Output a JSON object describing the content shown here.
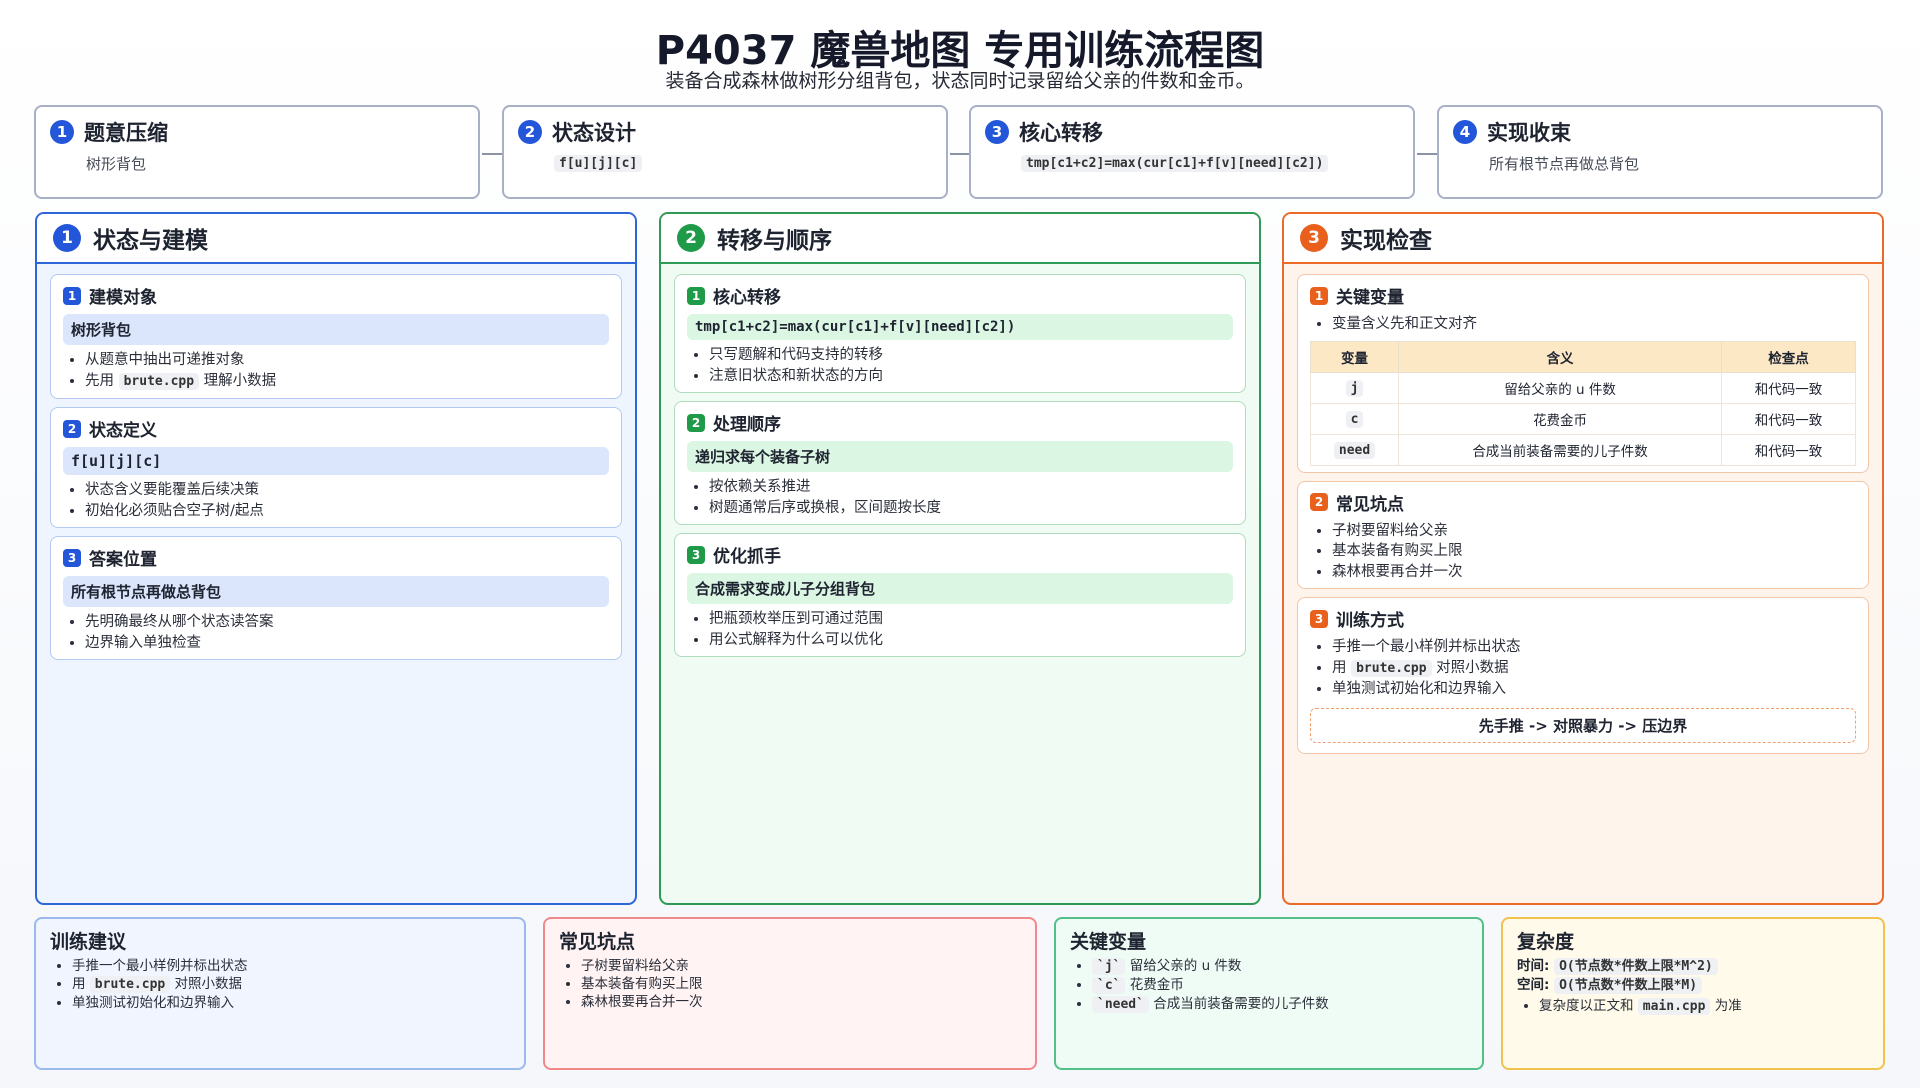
{
  "header": {
    "title": "P4037 魔兽地图 专用训练流程图",
    "subtitle": "装备合成森林做树形分组背包，状态同时记录留给父亲的件数和金币。"
  },
  "flow": [
    {
      "num": "1",
      "title": "题意压缩",
      "desc": "树形背包",
      "mono": false
    },
    {
      "num": "2",
      "title": "状态设计",
      "desc": "f[u][j][c]",
      "mono": true
    },
    {
      "num": "3",
      "title": "核心转移",
      "desc": "tmp[c1+c2]=max(cur[c1]+f[v][need][c2])",
      "mono": true
    },
    {
      "num": "4",
      "title": "实现收束",
      "desc": "所有根节点再做总背包",
      "mono": false
    }
  ],
  "columns": {
    "state": {
      "num": "1",
      "title": "状态与建模",
      "items": [
        {
          "num": "1",
          "title": "建模对象",
          "highlight": "树形背包",
          "bullets": [
            "从题意中抽出可递推对象"
          ],
          "b2_pre": "先用 ",
          "b2_code": "brute.cpp",
          "b2_post": " 理解小数据"
        },
        {
          "num": "2",
          "title": "状态定义",
          "highlight": "f[u][j][c]",
          "bullets": [
            "状态含义要能覆盖后续决策",
            "初始化必须贴合空子树/起点"
          ]
        },
        {
          "num": "3",
          "title": "答案位置",
          "highlight": "所有根节点再做总背包",
          "bullets": [
            "先明确最终从哪个状态读答案",
            "边界输入单独检查"
          ]
        }
      ]
    },
    "transfer": {
      "num": "2",
      "title": "转移与顺序",
      "items": [
        {
          "num": "1",
          "title": "核心转移",
          "highlight": "tmp[c1+c2]=max(cur[c1]+f[v][need][c2])",
          "bullets": [
            "只写题解和代码支持的转移",
            "注意旧状态和新状态的方向"
          ]
        },
        {
          "num": "2",
          "title": "处理顺序",
          "highlight": "递归求每个装备子树",
          "bullets": [
            "按依赖关系推进",
            "树题通常后序或换根，区间题按长度"
          ]
        },
        {
          "num": "3",
          "title": "优化抓手",
          "highlight": "合成需求变成儿子分组背包",
          "bullets": [
            "把瓶颈枚举压到可通过范围",
            "用公式解释为什么可以优化"
          ]
        }
      ]
    },
    "impl": {
      "num": "3",
      "title": "实现检查",
      "vars": {
        "num": "1",
        "title": "关键变量",
        "note": "变量含义先和正文对齐",
        "headers": [
          "变量",
          "含义",
          "检查点"
        ],
        "rows": [
          [
            "j",
            "留给父亲的 u 件数",
            "和代码一致"
          ],
          [
            "c",
            "花费金币",
            "和代码一致"
          ],
          [
            "need",
            "合成当前装备需要的儿子件数",
            "和代码一致"
          ]
        ]
      },
      "pitfalls": {
        "num": "2",
        "title": "常见坑点",
        "bullets": [
          "子树要留料给父亲",
          "基本装备有购买上限",
          "森林根要再合并一次"
        ]
      },
      "training": {
        "num": "3",
        "title": "训练方式",
        "b1": "手推一个最小样例并标出状态",
        "b2_pre": "用 ",
        "b2_code": "brute.cpp",
        "b2_post": " 对照小数据",
        "b3": "单独测试初始化和边界输入",
        "chip": "先手推 -> 对照暴力 -> 压边界"
      }
    }
  },
  "bottom": {
    "advice": {
      "title": "训练建议",
      "b1": "手推一个最小样例并标出状态",
      "b2_pre": "用 ",
      "b2_code": "brute.cpp",
      "b2_post": " 对照小数据",
      "b3": "单独测试初始化和边界输入"
    },
    "pitfalls": {
      "title": "常见坑点",
      "bullets": [
        "子树要留料给父亲",
        "基本装备有购买上限",
        "森林根要再合并一次"
      ]
    },
    "vars": {
      "title": "关键变量",
      "items": [
        {
          "code": "`j`",
          "text": " 留给父亲的 u 件数"
        },
        {
          "code": "`c`",
          "text": " 花费金币"
        },
        {
          "code": "`need`",
          "text": " 合成当前装备需要的儿子件数"
        }
      ]
    },
    "complexity": {
      "title": "复杂度",
      "time_label": "时间:",
      "time_value": "O(节点数*件数上限*M^2)",
      "space_label": "空间:",
      "space_value": "O(节点数*件数上限*M)",
      "note_pre": "复杂度以正文和 ",
      "note_code": "main.cpp",
      "note_post": " 为准"
    }
  },
  "colors": {
    "blue": "#2356d8",
    "green": "#1f9a48",
    "orange": "#e8601c"
  }
}
